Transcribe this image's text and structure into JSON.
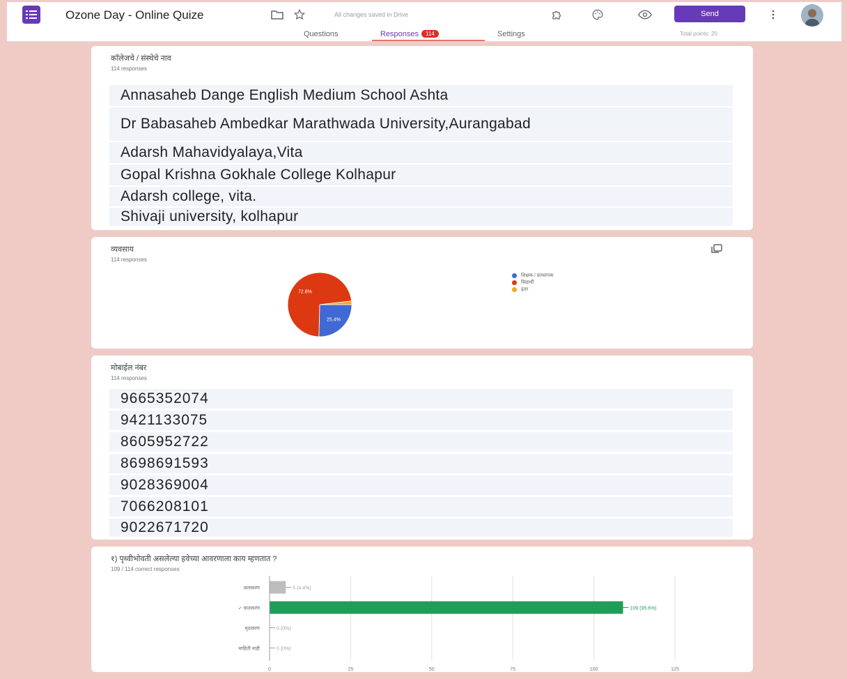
{
  "header": {
    "title": "Ozone Day - Online Quize",
    "save_status": "All changes saved in Drive",
    "send_label": "Send",
    "total_points": "Total points: 20",
    "icons": [
      "forms-logo-icon",
      "folder-icon",
      "star-icon",
      "addon-puzzle-icon",
      "palette-icon",
      "preview-eye-icon",
      "more-vert-icon"
    ]
  },
  "tabs": [
    {
      "label": "Questions"
    },
    {
      "label": "Responses",
      "badge": "114"
    },
    {
      "label": "Settings"
    }
  ],
  "colors": {
    "accent": "#673ab7",
    "page_bg": "#f0cbc6",
    "pie_blue": "#4169d4",
    "pie_red": "#dc3912",
    "pie_orange": "#f5a623",
    "bar_green": "#1e9e57",
    "bar_grey": "#bdbdbd"
  },
  "cards": {
    "college": {
      "title": "कॉलेजचे / संस्थेचे नाव",
      "sub": "114 responses",
      "responses": [
        "Annasaheb Dange English Medium School Ashta",
        "Dr Babasaheb Ambedkar Marathwada University,Aurangabad",
        "Adarsh Mahavidyalaya,Vita",
        "Gopal Krishna Gokhale College Kolhapur",
        "Adarsh college, vita.",
        "Shivaji university, kolhapur"
      ]
    },
    "occupation": {
      "title": "व्यवसाय",
      "sub": "114 responses",
      "chart_data": {
        "type": "pie",
        "labels": [
          "शिक्षक / प्राध्यापक",
          "विद्यार्थी",
          "इतर"
        ],
        "values": [
          25.4,
          72.8,
          1.8
        ],
        "data_labels": [
          "25.4%",
          "72.8%",
          ""
        ],
        "legend": "right"
      }
    },
    "mobile": {
      "title": "मोबाईल नंबर",
      "sub": "114 responses",
      "responses": [
        "9665352074",
        "9421133075",
        "8605952722",
        "8698691593",
        "9028369004",
        "7066208101",
        "9022671720"
      ]
    },
    "quiz": {
      "title": "१) पृथ्वीभोवती असलेल्या हवेच्या आवरणाला काय म्हणतात ?",
      "sub": "109 / 114 correct responses",
      "chart_data": {
        "type": "bar",
        "orientation": "horizontal",
        "categories": [
          "जलावरण",
          "✓ वातावरण",
          "मृदावरण",
          "माहिती नाही"
        ],
        "values": [
          5,
          109,
          0,
          0
        ],
        "data_labels": [
          "5 (4.4%)",
          "109 (95.6%)",
          "0 (0%)",
          "0 (0%)"
        ],
        "correct_index": 1,
        "xlim": [
          0,
          125
        ],
        "xticks": [
          "0",
          "25",
          "50",
          "75",
          "100",
          "125"
        ],
        "grid": true
      }
    }
  }
}
